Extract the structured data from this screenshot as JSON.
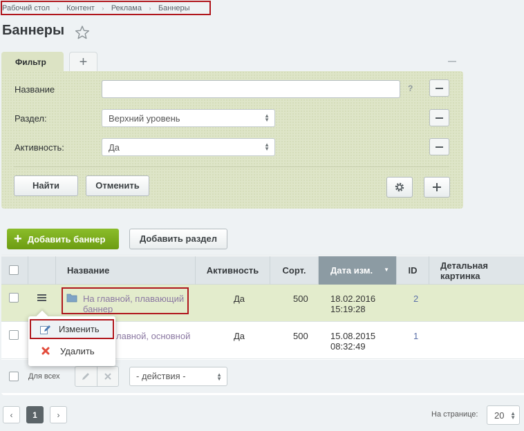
{
  "breadcrumb": [
    "Рабочий стол",
    "Контент",
    "Реклама",
    "Баннеры"
  ],
  "page_title": "Баннеры",
  "filter": {
    "tab_label": "Фильтр",
    "add_tab": "+",
    "fields": {
      "name_label": "Название",
      "name_value": "",
      "help": "?",
      "section_label": "Раздел:",
      "section_value": "Верхний уровень",
      "activity_label": "Активность:",
      "activity_value": "Да"
    },
    "find_button": "Найти",
    "cancel_button": "Отменить"
  },
  "toolbar": {
    "add_banner": "Добавить баннер",
    "add_section": "Добавить раздел"
  },
  "table": {
    "columns": {
      "name": "Название",
      "activity": "Активность",
      "sort": "Сорт.",
      "date": "Дата изм.",
      "id": "ID",
      "detail": "Детальная картинка"
    },
    "rows": [
      {
        "name": "На главной, плавающий баннер",
        "activity": "Да",
        "sort": "500",
        "date": "18.02.2016",
        "time": "15:19:28",
        "id": "2"
      },
      {
        "name": "лавной, основной",
        "activity": "Да",
        "sort": "500",
        "date": "15.08.2015",
        "time": "08:32:49",
        "id": "1"
      }
    ]
  },
  "context_menu": {
    "edit": "Изменить",
    "delete": "Удалить"
  },
  "footer": {
    "for_all": "Для всех",
    "actions": "- действия -"
  },
  "pagination": {
    "current": "1",
    "per_page_label": "На странице:",
    "per_page_value": "20"
  },
  "colors": {
    "accent_green": "#7aab1b",
    "highlight_red": "#b0161c",
    "filter_bg": "#dee5c8"
  }
}
